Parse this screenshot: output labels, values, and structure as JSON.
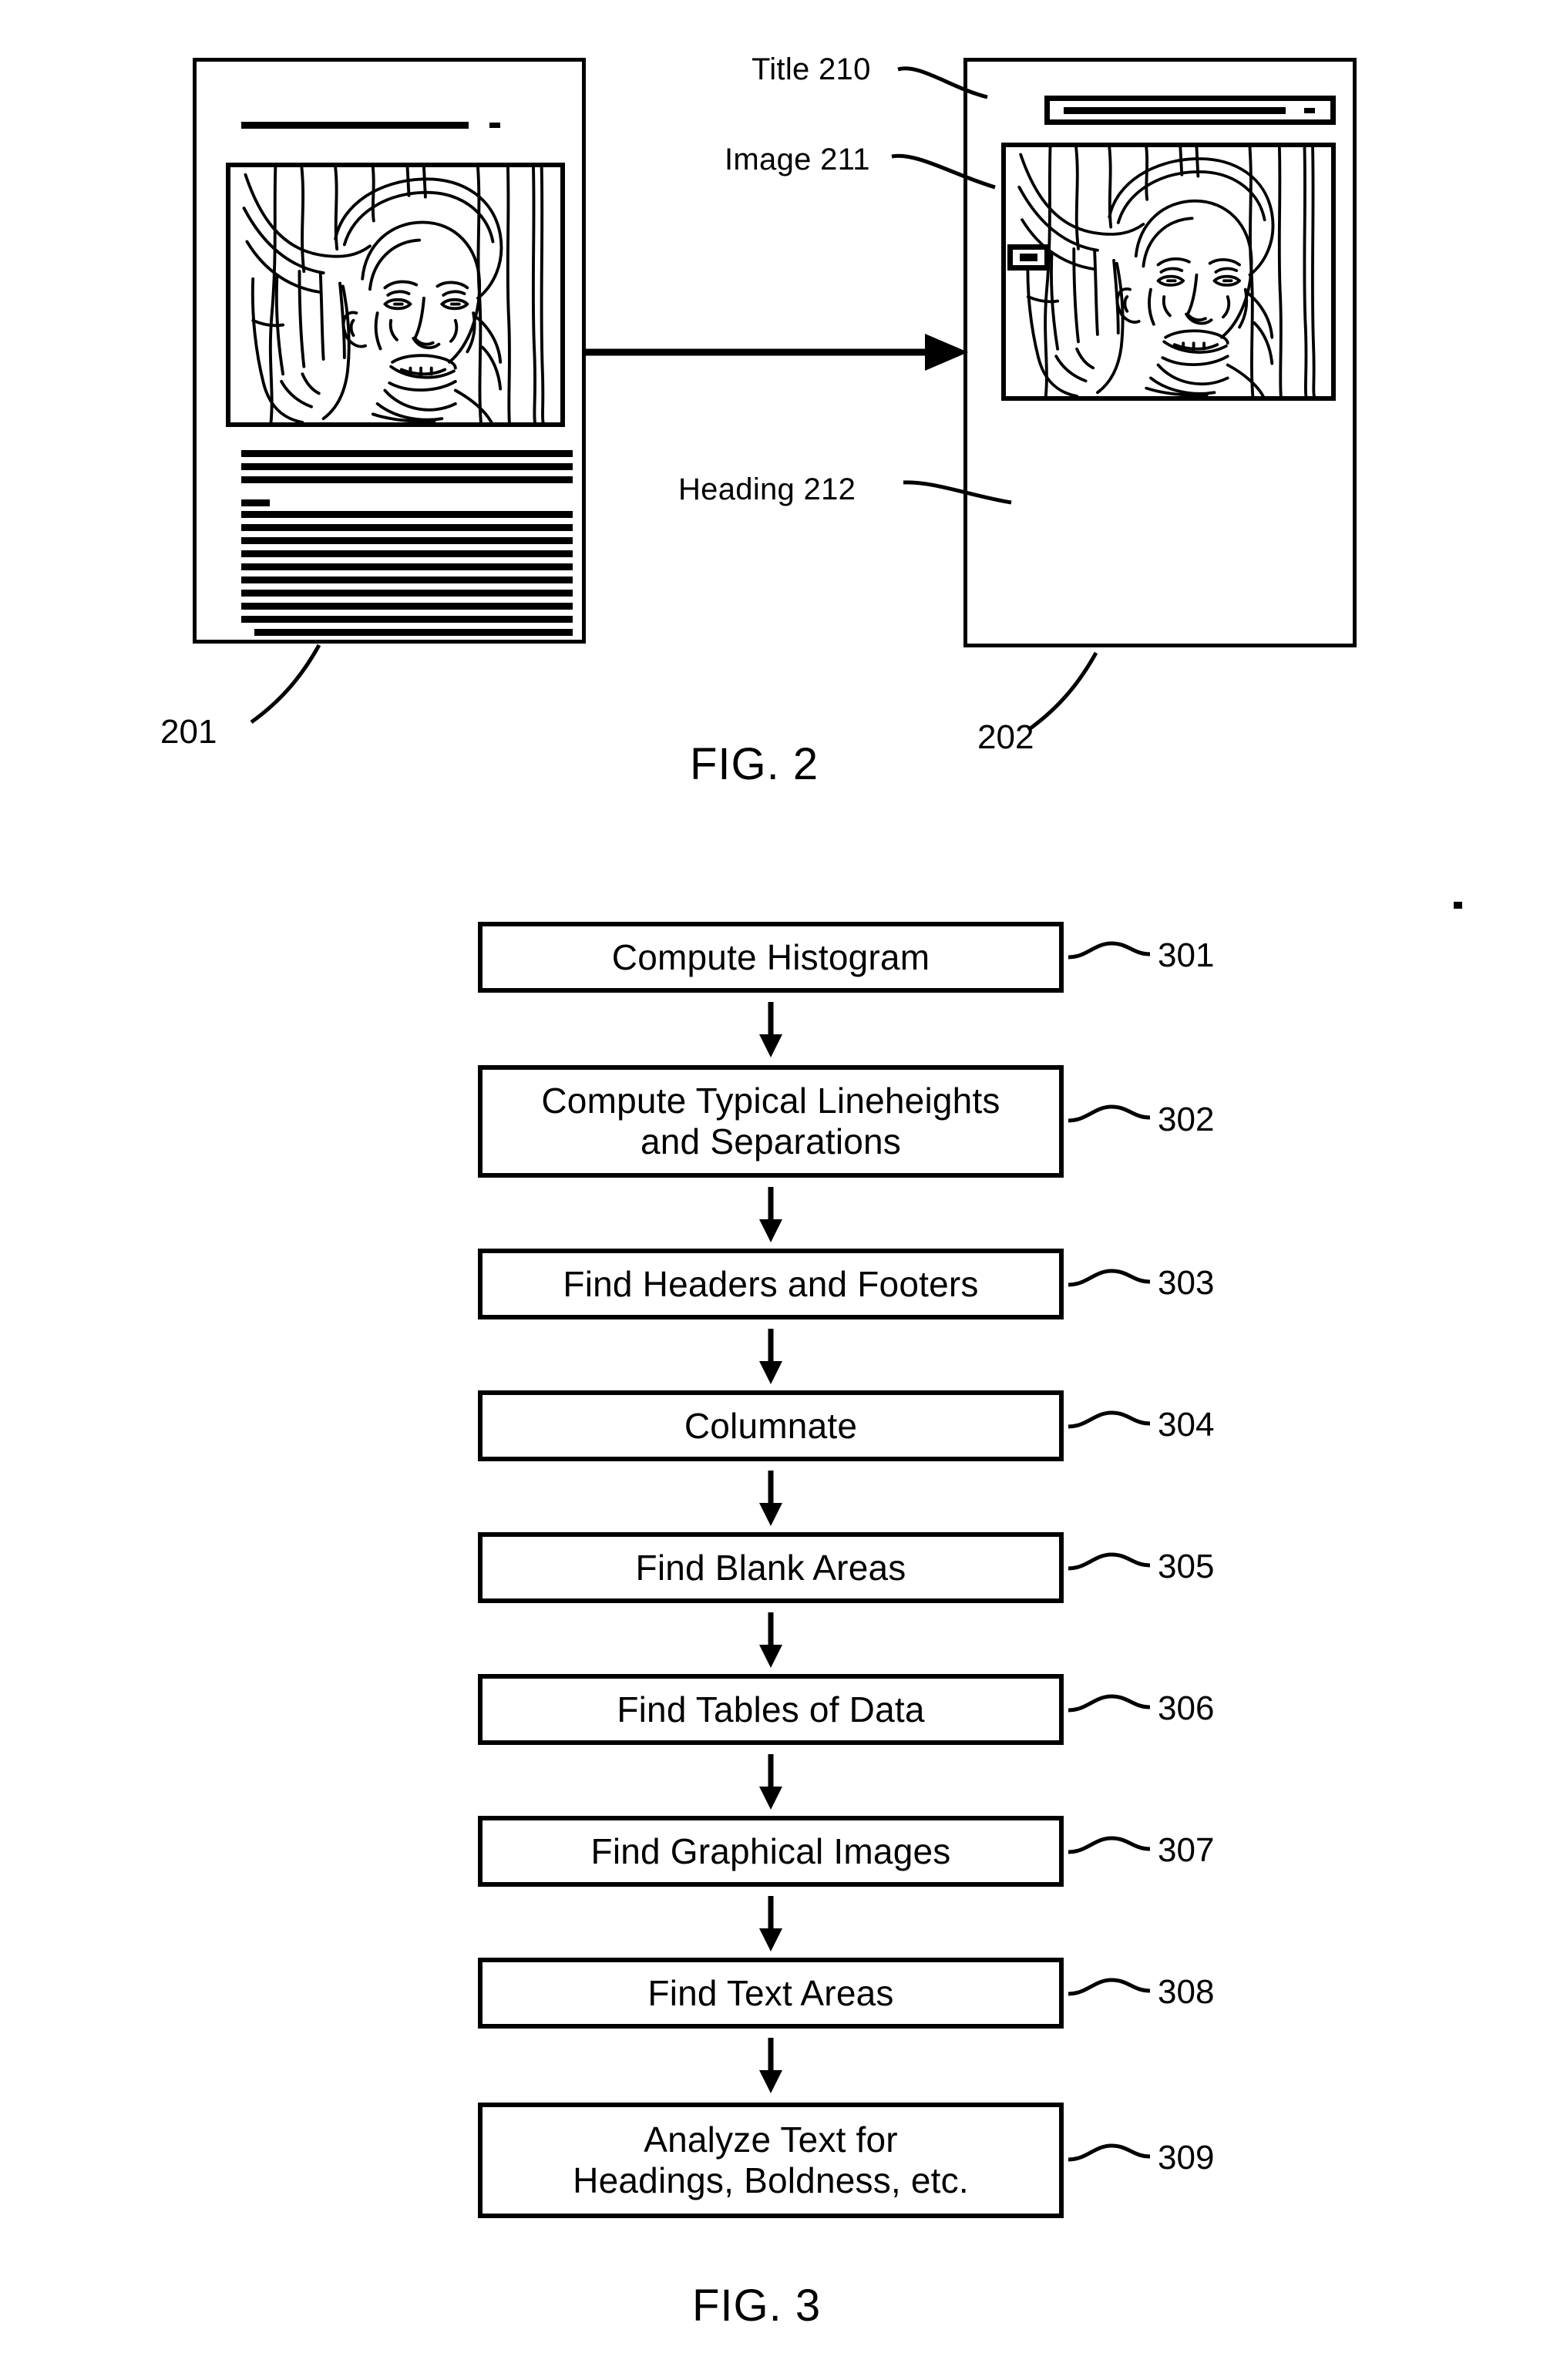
{
  "figure2": {
    "caption": "FIG. 2",
    "labels": [
      {
        "id": "title-210",
        "text": "Title 210"
      },
      {
        "id": "image-211",
        "text": "Image 211"
      },
      {
        "id": "heading-212",
        "text": "Heading 212"
      }
    ],
    "source_document": {
      "ref": "201",
      "description": "original page layout with title rule, photographic image and body text"
    },
    "result_document": {
      "ref": "202",
      "description": "reformatted page with boxed title region, image region and heading marker"
    },
    "transform_arrow": {
      "direction": "right"
    }
  },
  "figure3": {
    "caption": "FIG. 3",
    "steps": [
      {
        "ref": "301",
        "label": "Compute Histogram"
      },
      {
        "ref": "302",
        "label": "Compute Typical Lineheights\nand Separations"
      },
      {
        "ref": "303",
        "label": "Find Headers and Footers"
      },
      {
        "ref": "304",
        "label": "Columnate"
      },
      {
        "ref": "305",
        "label": "Find Blank Areas"
      },
      {
        "ref": "306",
        "label": "Find Tables of Data"
      },
      {
        "ref": "307",
        "label": "Find Graphical Images"
      },
      {
        "ref": "308",
        "label": "Find Text Areas"
      },
      {
        "ref": "309",
        "label": "Analyze Text for\nHeadings, Boldness, etc."
      }
    ]
  },
  "colors": {
    "ink": "#000000",
    "paper": "#ffffff"
  }
}
